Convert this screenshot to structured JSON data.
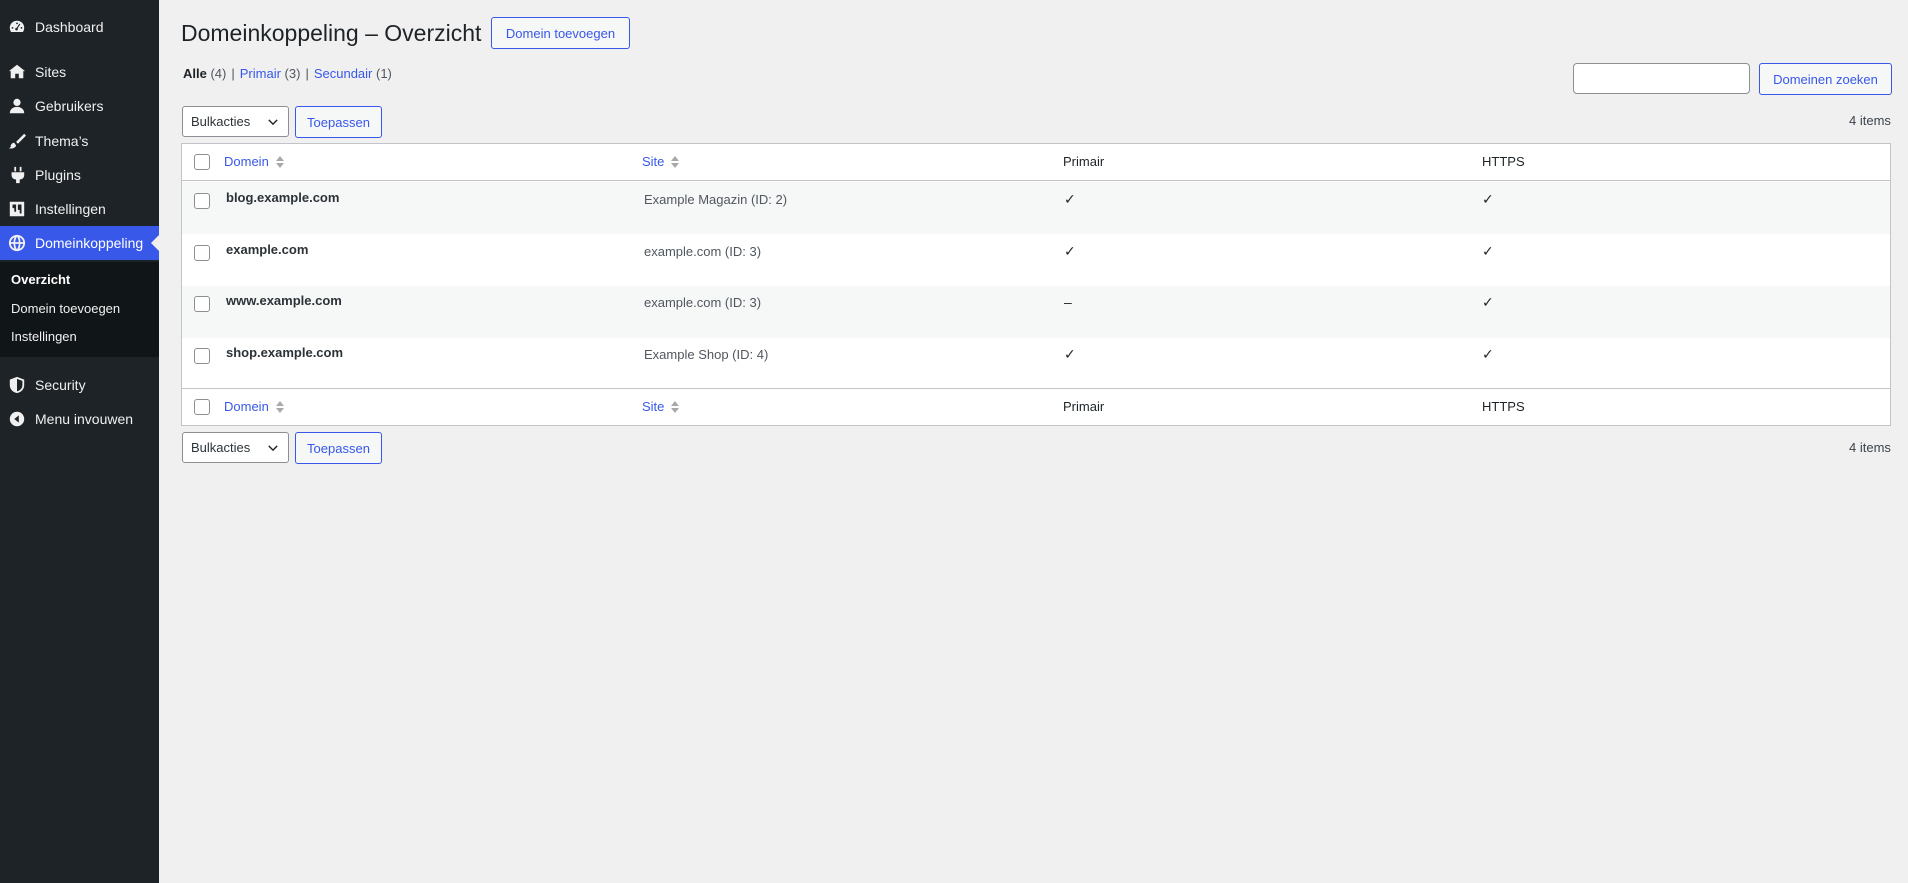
{
  "sidebar": {
    "items": [
      {
        "label": "Dashboard",
        "icon": "dashboard-icon"
      },
      {
        "label": "Sites",
        "icon": "sites-icon"
      },
      {
        "label": "Gebruikers",
        "icon": "users-icon"
      },
      {
        "label": "Thema’s",
        "icon": "brush-icon"
      },
      {
        "label": "Plugins",
        "icon": "plugin-icon"
      },
      {
        "label": "Instellingen",
        "icon": "settings-icon"
      },
      {
        "label": "Domeinkoppeling",
        "icon": "globe-icon"
      },
      {
        "label": "Security",
        "icon": "shield-icon"
      },
      {
        "label": "Menu invouwen",
        "icon": "collapse-icon"
      }
    ],
    "submenu": [
      "Overzicht",
      "Domein toevoegen",
      "Instellingen"
    ]
  },
  "header": {
    "title": "Domeinkoppeling – Overzicht",
    "add_button": "Domein toevoegen"
  },
  "filters": {
    "all_label": "Alle",
    "all_count": "(4)",
    "primary_label": "Primair",
    "primary_count": "(3)",
    "secondary_label": "Secundair",
    "secondary_count": "(1)",
    "separator": "|"
  },
  "search": {
    "value": "",
    "button": "Domeinen zoeken"
  },
  "bulk": {
    "select_value": "Bulkacties",
    "apply_button": "Toepassen",
    "count": "4 items"
  },
  "table": {
    "columns": [
      "Domein",
      "Site",
      "Primair",
      "HTTPS"
    ],
    "rows": [
      {
        "domain": "blog.example.com",
        "site": "Example Magazin (ID: 2)",
        "primary": "✓",
        "https": "✓"
      },
      {
        "domain": "example.com",
        "site": "example.com (ID: 3)",
        "primary": "✓",
        "https": "✓"
      },
      {
        "domain": "www.example.com",
        "site": "example.com (ID: 3)",
        "primary": "–",
        "https": "✓"
      },
      {
        "domain": "shop.example.com",
        "site": "Example Shop (ID: 4)",
        "primary": "✓",
        "https": "✓"
      }
    ]
  },
  "colors": {
    "sidebar_bg": "#1d2327",
    "accent": "#3858e9",
    "page_bg": "#f0f0f1"
  }
}
